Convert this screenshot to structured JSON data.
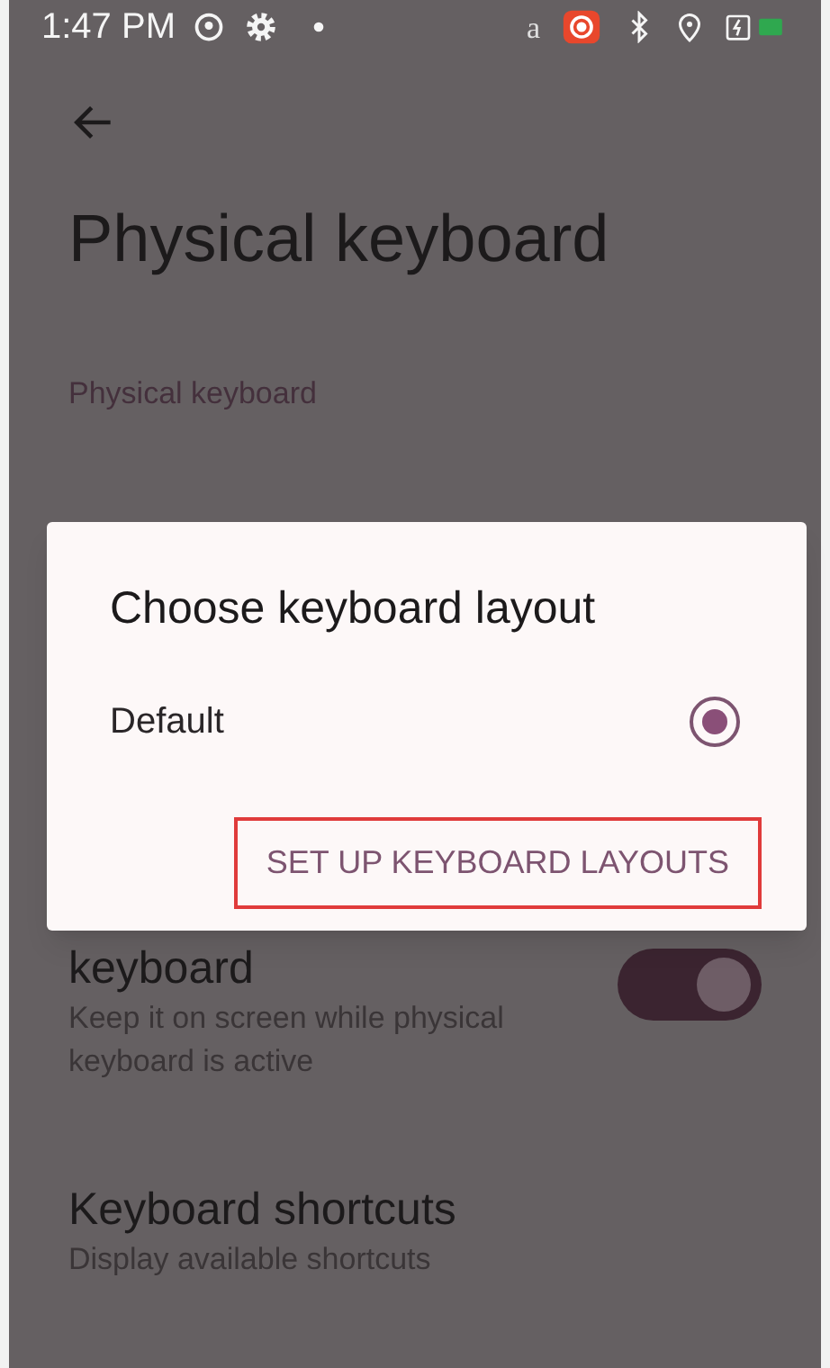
{
  "status_bar": {
    "time": "1:47 PM",
    "letter": "a"
  },
  "page": {
    "title": "Physical keyboard",
    "section": "Physical keyboard"
  },
  "settings": [
    {
      "kind": "toggle",
      "title": "keyboard",
      "subtitle": "Keep it on screen while physical keyboard is active",
      "on": true
    },
    {
      "kind": "plain",
      "title": "Keyboard shortcuts",
      "subtitle": "Display available shortcuts"
    }
  ],
  "dialog": {
    "title": "Choose keyboard layout",
    "options": [
      {
        "label": "Default",
        "selected": true
      }
    ],
    "button": "SET UP KEYBOARD LAYOUTS"
  }
}
